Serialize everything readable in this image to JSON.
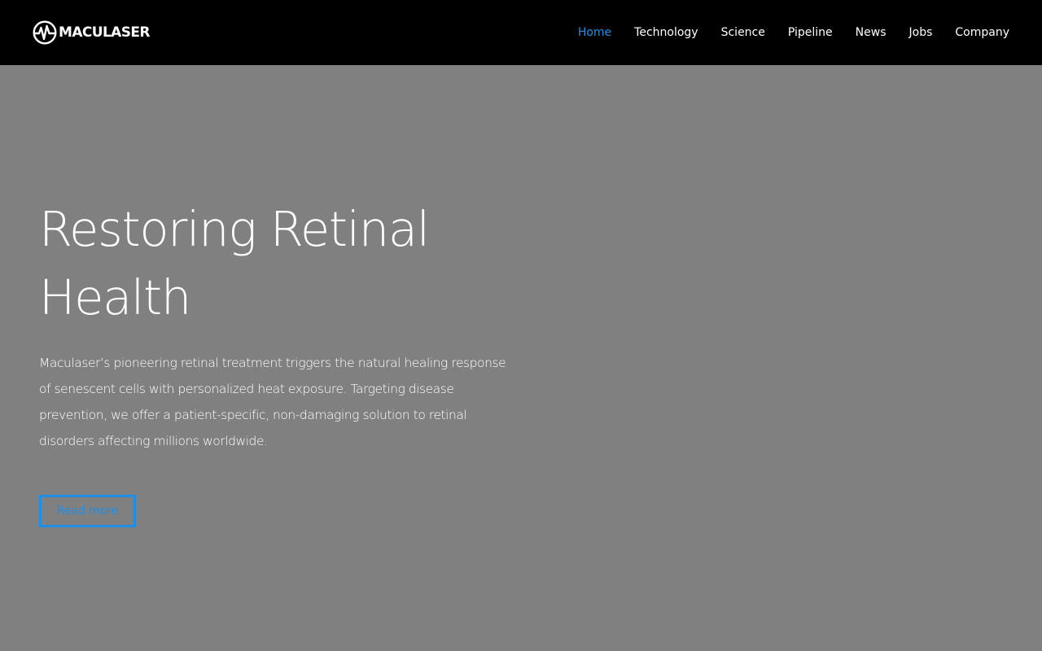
{
  "brand": {
    "name": "MACULASER",
    "logo_icon": "heartbeat-circle-icon"
  },
  "nav": {
    "items": [
      {
        "label": "Home",
        "active": true
      },
      {
        "label": "Technology",
        "active": false
      },
      {
        "label": "Science",
        "active": false
      },
      {
        "label": "Pipeline",
        "active": false
      },
      {
        "label": "News",
        "active": false
      },
      {
        "label": "Jobs",
        "active": false
      },
      {
        "label": "Company",
        "active": false
      }
    ]
  },
  "hero": {
    "title_line1": "Restoring Retinal",
    "title_line2": "Health",
    "body": "Maculaser’s pioneering retinal treatment triggers the natural healing response of senescent cells with personalized heat exposure. Targeting disease prevention, we offer a patient-specific, non-damaging solution to retinal disorders affecting millions worldwide.",
    "cta_label": "Read more"
  },
  "colors": {
    "header_bg": "#000000",
    "hero_bg": "#808080",
    "accent": "#1e8ee6",
    "text": "#ffffff"
  }
}
